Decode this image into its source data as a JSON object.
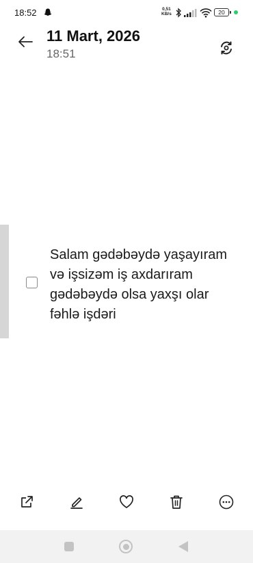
{
  "status_bar": {
    "time": "18:52",
    "net_speed_value": "0,51",
    "net_speed_unit": "KB/s",
    "battery": "20",
    "icons": [
      "snapchat-icon",
      "bluetooth-icon",
      "signal-icon",
      "wifi-icon",
      "battery-icon"
    ],
    "charge_dot_color": "#2ecc71"
  },
  "header": {
    "date": "11 Mart, 2026",
    "time": "18:51",
    "icons": [
      "arrow-left-icon",
      "sync-icon"
    ]
  },
  "note": {
    "items": [
      {
        "checked": false,
        "text": "Salam gədəbəydə yaşayıram və işsizəm iş axdarıram gədəbəydə olsa yaxşı olar fəhlə işdəri"
      }
    ]
  },
  "toolbar": {
    "icons": [
      "share-icon",
      "edit-icon",
      "heart-icon",
      "trash-icon",
      "more-icon"
    ]
  },
  "nav_bar": {
    "icons": [
      "recents-square-icon",
      "home-circle-icon",
      "back-triangle-icon"
    ]
  }
}
